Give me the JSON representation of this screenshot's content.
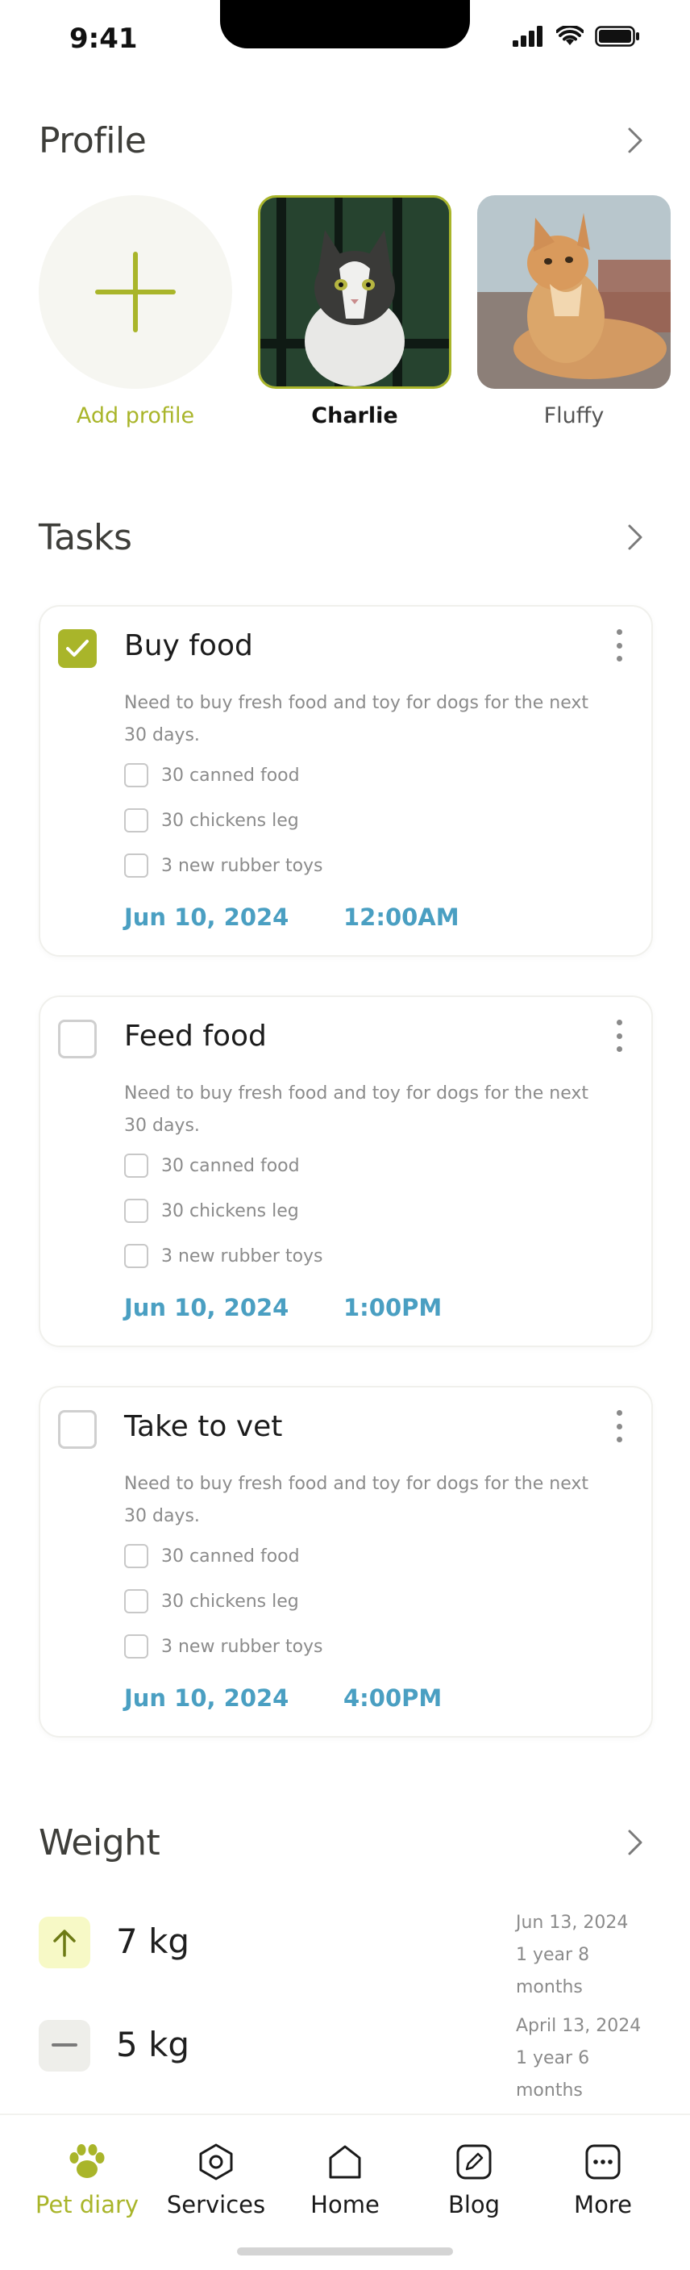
{
  "status_bar": {
    "time": "9:41"
  },
  "profile": {
    "title": "Profile",
    "add_label": "Add profile",
    "pets": [
      {
        "name": "Charlie",
        "selected": true
      },
      {
        "name": "Fluffy",
        "selected": false
      }
    ]
  },
  "tasks": {
    "title": "Tasks",
    "items": [
      {
        "title": "Buy food",
        "completed": true,
        "description": "Need to buy fresh food and toy for dogs for the next 30 days.",
        "subtasks": [
          "30 canned food",
          "30 chickens leg",
          "3 new rubber toys"
        ],
        "date": "Jun 10, 2024",
        "time": "12:00AM"
      },
      {
        "title": "Feed food",
        "completed": false,
        "description": "Need to buy fresh food and toy for dogs for the next 30 days.",
        "subtasks": [
          "30 canned food",
          "30 chickens leg",
          "3 new rubber toys"
        ],
        "date": "Jun 10, 2024",
        "time": "1:00PM"
      },
      {
        "title": "Take to vet",
        "completed": false,
        "description": "Need to buy fresh food and toy for dogs for the next 30 days.",
        "subtasks": [
          "30 canned food",
          "30 chickens leg",
          "3 new rubber toys"
        ],
        "date": "Jun 10, 2024",
        "time": "4:00PM"
      }
    ]
  },
  "weight": {
    "title": "Weight",
    "entries": [
      {
        "value": "7 kg",
        "trend": "up-arrow-icon",
        "date": "Jun 13, 2024",
        "age": "1 year 8 months"
      },
      {
        "value": "5 kg",
        "trend": "minus-icon",
        "date": "April 13, 2024",
        "age": "1 year 6 months"
      }
    ]
  },
  "bottom_nav": {
    "items": [
      {
        "label": "Pet diary",
        "icon": "paw-icon",
        "active": true
      },
      {
        "label": "Services",
        "icon": "services-icon",
        "active": false
      },
      {
        "label": "Home",
        "icon": "home-icon",
        "active": false
      },
      {
        "label": "Blog",
        "icon": "blog-icon",
        "active": false
      },
      {
        "label": "More",
        "icon": "more-icon",
        "active": false
      }
    ]
  },
  "colors": {
    "accent": "#a9b52a",
    "link_blue": "#4a9fc2",
    "muted_text": "#8b8b8b"
  }
}
